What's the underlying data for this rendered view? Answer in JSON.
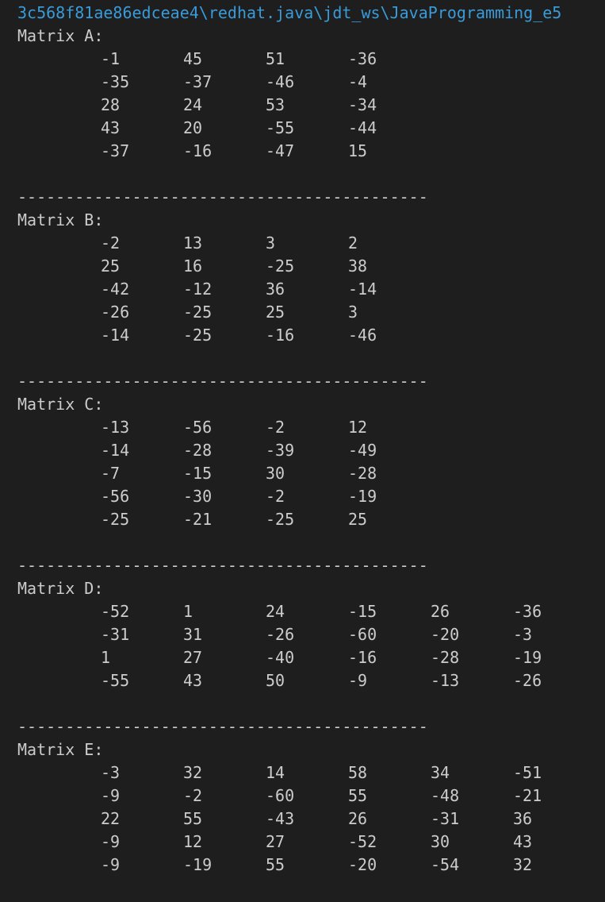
{
  "path_line": "3c568f81ae86edceae4\\redhat.java\\jdt_ws\\JavaProgramming_e5",
  "separator": "-------------------------------------------",
  "matrices": [
    {
      "label": "Matrix A:",
      "rows": [
        [
          "-1",
          "45",
          "51",
          "-36"
        ],
        [
          "-35",
          "-37",
          "-46",
          "-4"
        ],
        [
          "28",
          "24",
          "53",
          "-34"
        ],
        [
          "43",
          "20",
          "-55",
          "-44"
        ],
        [
          "-37",
          "-16",
          "-47",
          "15"
        ]
      ]
    },
    {
      "label": "Matrix B:",
      "rows": [
        [
          "-2",
          "13",
          "3",
          "2"
        ],
        [
          "25",
          "16",
          "-25",
          "38"
        ],
        [
          "-42",
          "-12",
          "36",
          "-14"
        ],
        [
          "-26",
          "-25",
          "25",
          "3"
        ],
        [
          "-14",
          "-25",
          "-16",
          "-46"
        ]
      ]
    },
    {
      "label": "Matrix C:",
      "rows": [
        [
          "-13",
          "-56",
          "-2",
          "12"
        ],
        [
          "-14",
          "-28",
          "-39",
          "-49"
        ],
        [
          "-7",
          "-15",
          "30",
          "-28"
        ],
        [
          "-56",
          "-30",
          "-2",
          "-19"
        ],
        [
          "-25",
          "-21",
          "-25",
          "25"
        ]
      ]
    },
    {
      "label": "Matrix D:",
      "rows": [
        [
          "-52",
          "1",
          "24",
          "-15",
          "26",
          "-36"
        ],
        [
          "-31",
          "31",
          "-26",
          "-60",
          "-20",
          "-3"
        ],
        [
          "1",
          "27",
          "-40",
          "-16",
          "-28",
          "-19"
        ],
        [
          "-55",
          "43",
          "50",
          "-9",
          "-13",
          "-26"
        ]
      ]
    },
    {
      "label": "Matrix E:",
      "rows": [
        [
          "-3",
          "32",
          "14",
          "58",
          "34",
          "-51"
        ],
        [
          "-9",
          "-2",
          "-60",
          "55",
          "-48",
          "-21"
        ],
        [
          "22",
          "55",
          "-43",
          "26",
          "-31",
          "36"
        ],
        [
          "-9",
          "12",
          "27",
          "-52",
          "30",
          "43"
        ],
        [
          "-9",
          "-19",
          "55",
          "-20",
          "-54",
          "32"
        ]
      ]
    }
  ]
}
